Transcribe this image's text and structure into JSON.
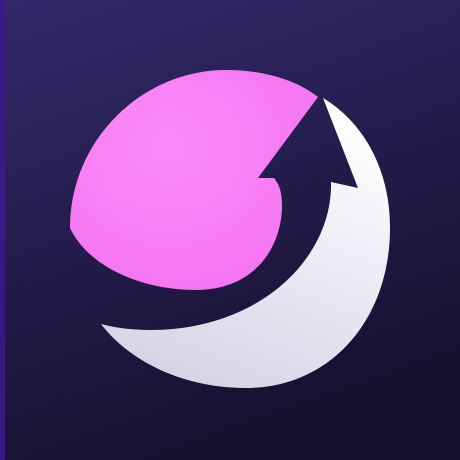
{
  "app_icon": {
    "icon": "pink-sphere-with-crescent-arrow-icon",
    "colors": {
      "background_top": "#33296b",
      "background_bottom": "#15112f",
      "edge_accent": "#3b1a8a",
      "sphere": "#f472f2",
      "sphere_highlight": "#fb8cf8",
      "crescent_light": "#ffffff",
      "crescent_shade": "#d6d3e6"
    }
  }
}
